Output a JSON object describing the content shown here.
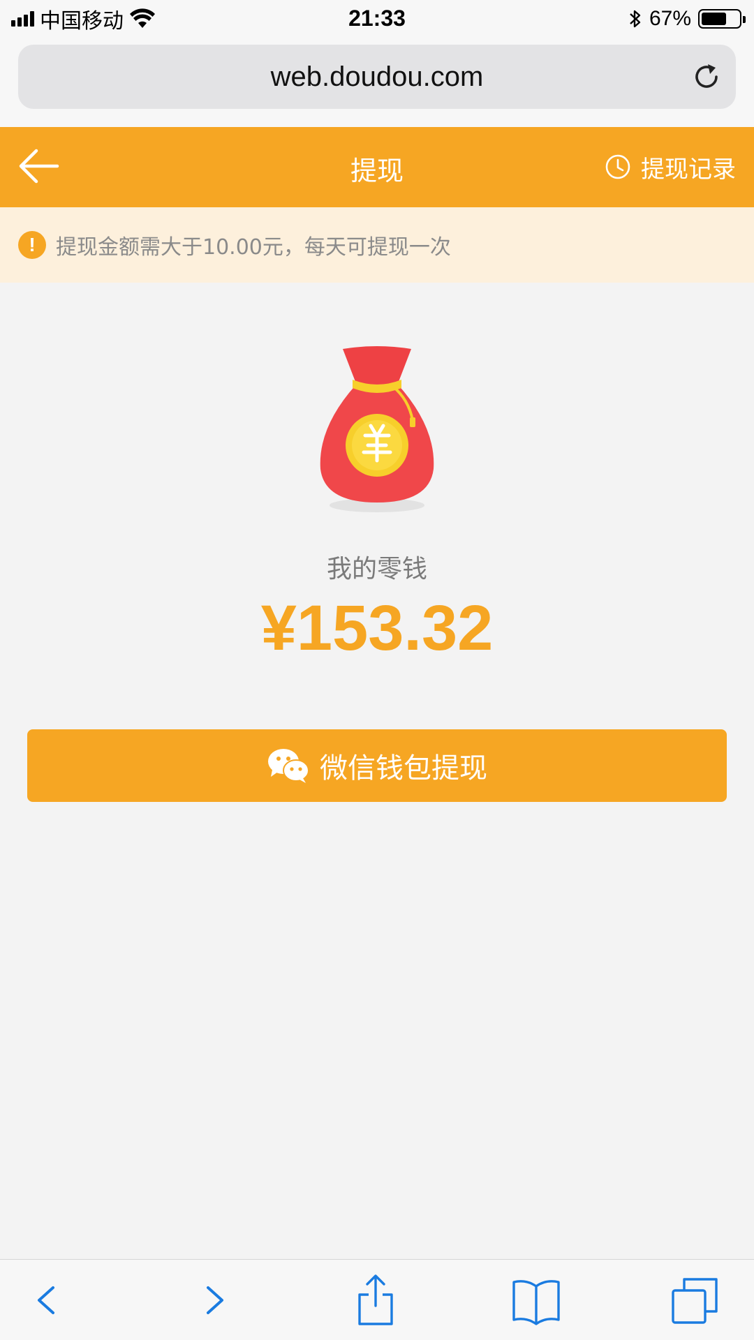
{
  "status_bar": {
    "carrier": "中国移动",
    "time": "21:33",
    "battery_percent": "67%",
    "battery_level": 0.67,
    "icons": [
      "signal-icon",
      "wifi-icon",
      "bluetooth-icon",
      "battery-icon"
    ]
  },
  "browser": {
    "url": "web.doudou.com",
    "reload_icon": "reload-icon"
  },
  "header": {
    "back_icon": "back-arrow-icon",
    "title": "提现",
    "history_label": "提现记录",
    "history_icon": "clock-icon"
  },
  "notice": {
    "icon": "warning-icon",
    "icon_glyph": "!",
    "text": "提现金额需大于10.00元，每天可提现一次"
  },
  "wallet": {
    "image": "money-bag-icon",
    "label": "我的零钱",
    "balance": "¥153.32"
  },
  "withdraw_button": {
    "icon": "wechat-icon",
    "label": "微信钱包提现"
  },
  "toolbar": {
    "items": [
      "back-icon",
      "forward-icon",
      "share-icon",
      "bookmarks-icon",
      "tabs-icon"
    ]
  },
  "colors": {
    "accent": "#f6a623",
    "notice_bg": "#fdf0dc",
    "page_bg": "#f3f3f3",
    "bag_red": "#f0474a",
    "ios_blue": "#1a7be0"
  }
}
